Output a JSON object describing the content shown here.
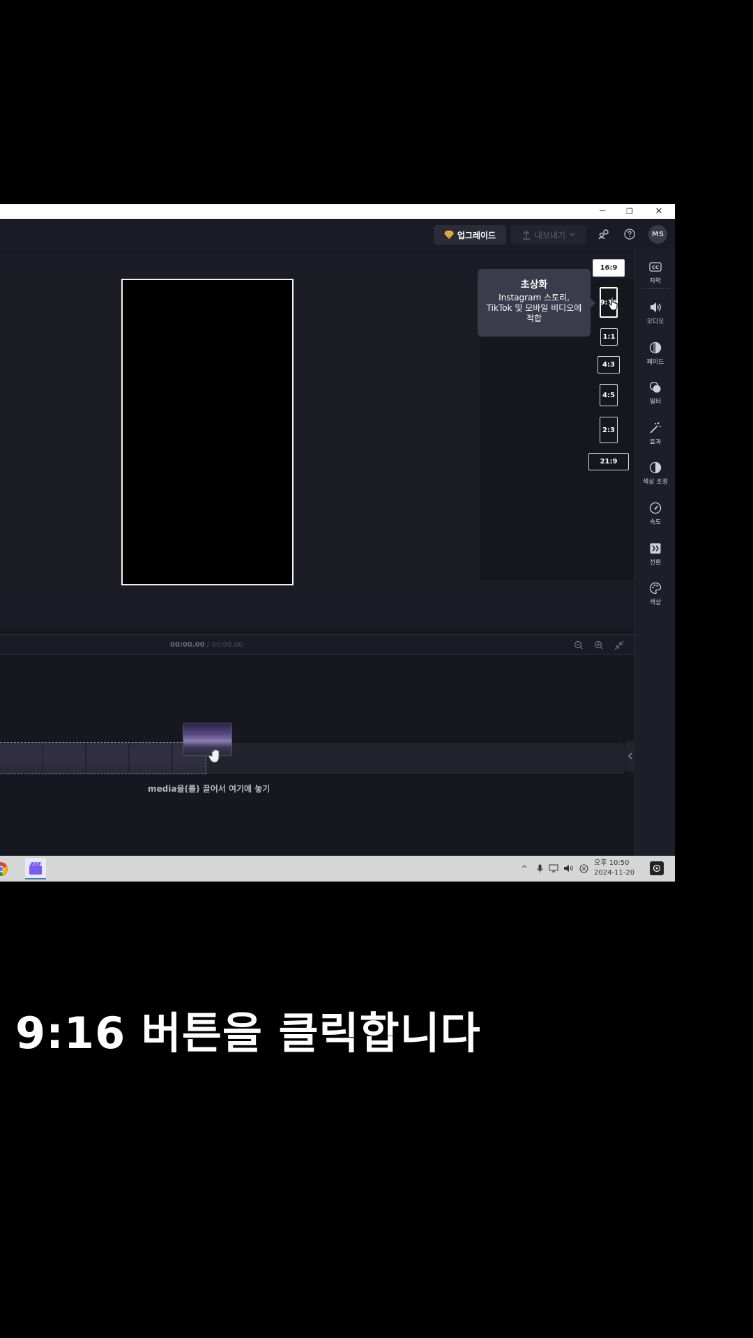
{
  "window": {
    "controls": {
      "minimize": "─",
      "restore": "❐",
      "close": "✕"
    }
  },
  "header": {
    "upgrade_label": "업그레이드",
    "export_label": "내보내기",
    "avatar_initials": "MS",
    "accent_color": "#f5b24a"
  },
  "tooltip": {
    "title": "초상화",
    "body": "Instagram 스토리, TikTok 및 모바일 비디오에 적합"
  },
  "aspect_ratios": [
    {
      "label": "16:9",
      "state": "current"
    },
    {
      "label": "9:16",
      "state": "hovered"
    },
    {
      "label": "1:1"
    },
    {
      "label": "4:3"
    },
    {
      "label": "4:5"
    },
    {
      "label": "2:3"
    },
    {
      "label": "21:9"
    }
  ],
  "sidebar": {
    "items": [
      {
        "label": "자막",
        "icon": "cc-icon"
      },
      {
        "label": "오디오",
        "icon": "speaker-icon"
      },
      {
        "label": "페이드",
        "icon": "fade-icon"
      },
      {
        "label": "필터",
        "icon": "filter-icon"
      },
      {
        "label": "효과",
        "icon": "magic-wand-icon"
      },
      {
        "label": "색상 조정",
        "icon": "contrast-icon"
      },
      {
        "label": "속도",
        "icon": "speedometer-icon"
      },
      {
        "label": "전환",
        "icon": "transition-icon"
      },
      {
        "label": "색상",
        "icon": "palette-icon"
      }
    ]
  },
  "timeline": {
    "current_time": "00:00.00",
    "total_time": "/ 00:00.00",
    "drop_hint": "media을(를) 끌어서 여기에 놓기"
  },
  "taskbar": {
    "tray_expand": "^",
    "clock_time": "오후 10:50",
    "clock_date": "2024-11-20"
  },
  "caption": "9:16 버튼을 클릭합니다"
}
